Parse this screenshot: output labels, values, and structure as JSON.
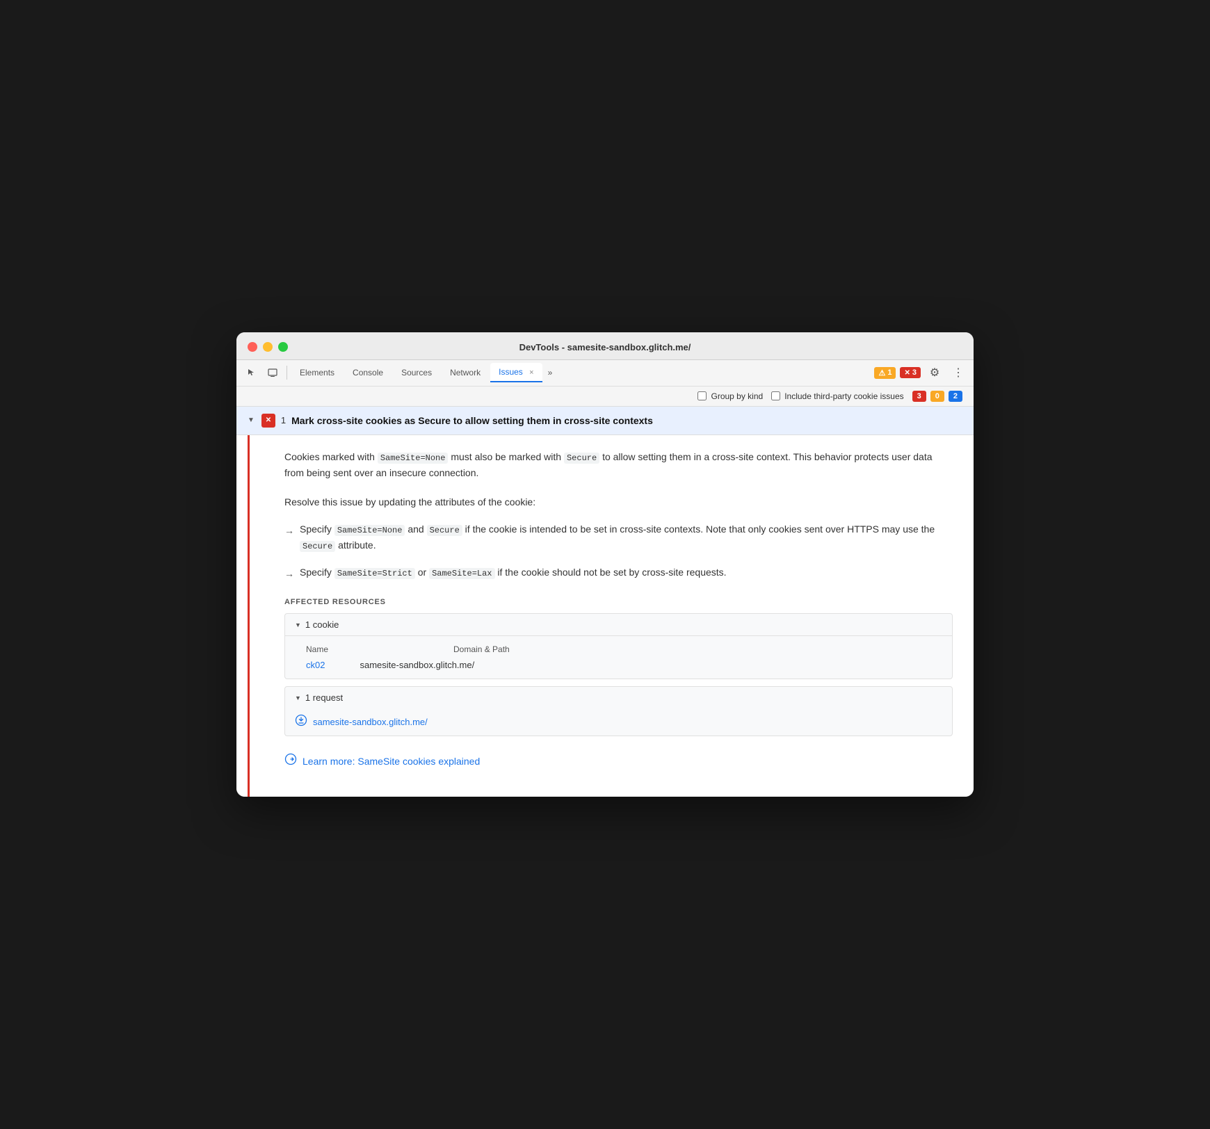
{
  "window": {
    "title": "DevTools - samesite-sandbox.glitch.me/"
  },
  "tabs": {
    "items": [
      {
        "label": "Elements",
        "active": false
      },
      {
        "label": "Console",
        "active": false
      },
      {
        "label": "Sources",
        "active": false
      },
      {
        "label": "Network",
        "active": false
      },
      {
        "label": "Issues",
        "active": true
      }
    ],
    "more_label": "»",
    "close_label": "×"
  },
  "badges": {
    "warning_count": "1",
    "error_count": "3"
  },
  "filter_bar": {
    "group_by_kind": "Group by kind",
    "include_third_party": "Include third-party cookie issues",
    "error_count": "3",
    "warning_count": "0",
    "info_count": "2"
  },
  "issue": {
    "count": "1",
    "title": "Mark cross-site cookies as Secure to allow setting them in cross-site contexts",
    "description_1": "Cookies marked with ",
    "code_1": "SameSite=None",
    "description_2": " must also be marked with ",
    "code_2": "Secure",
    "description_3": " to allow setting them in a cross-site context. This behavior protects user data from being sent over an insecure connection.",
    "resolve_text": "Resolve this issue by updating the attributes of the cookie:",
    "bullet1_text1": "Specify ",
    "bullet1_code1": "SameSite=None",
    "bullet1_text2": " and ",
    "bullet1_code2": "Secure",
    "bullet1_text3": " if the cookie is intended to be set in cross-site contexts. Note that only cookies sent over HTTPS may use the ",
    "bullet1_code3": "Secure",
    "bullet1_text4": " attribute.",
    "bullet2_text1": "Specify ",
    "bullet2_code1": "SameSite=Strict",
    "bullet2_text2": " or ",
    "bullet2_code2": "SameSite=Lax",
    "bullet2_text3": " if the cookie should not be set by cross-site requests.",
    "affected_label": "AFFECTED RESOURCES",
    "cookie_section": {
      "label": "1 cookie",
      "col_name": "Name",
      "col_domain": "Domain & Path",
      "cookie_name": "ck02",
      "cookie_domain": "samesite-sandbox.glitch.me/"
    },
    "request_section": {
      "label": "1 request",
      "request_url": "samesite-sandbox.glitch.me/"
    },
    "learn_more": {
      "text": "Learn more: SameSite cookies explained",
      "url": "#"
    }
  },
  "icons": {
    "cursor": "⬚",
    "device": "⬜",
    "chevron_down": "▼",
    "arrow_right": "→",
    "gear": "⚙",
    "more": "⋮",
    "warning": "⚠",
    "error": "✕",
    "info": "💬",
    "close": "×",
    "download": "⊙"
  },
  "colors": {
    "active_tab": "#1a73e8",
    "error_red": "#d93025",
    "warning_yellow": "#f9a825",
    "info_blue": "#1a73e8",
    "left_border": "#d93025"
  }
}
